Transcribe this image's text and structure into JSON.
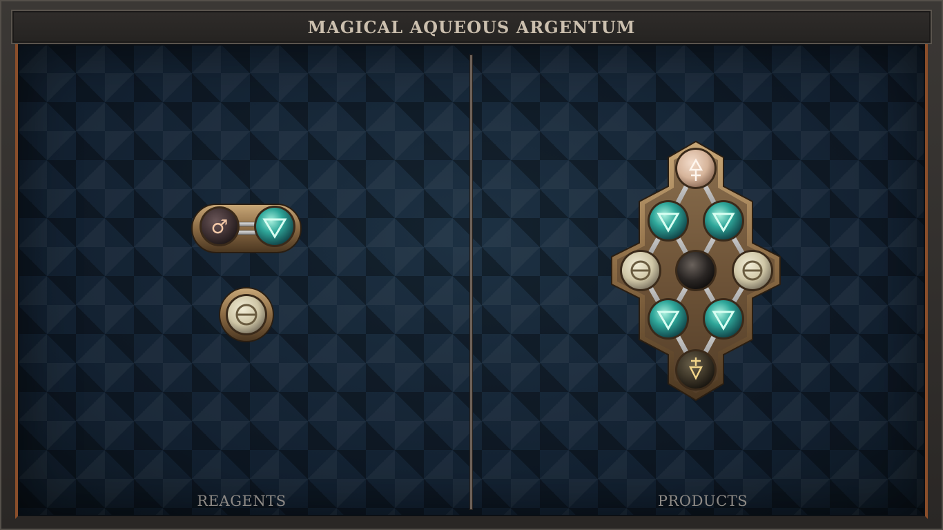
{
  "title": "MAGICAL AQUEOUS ARGENTUM",
  "sections": {
    "reagents_label": "REAGENTS",
    "products_label": "PRODUCTS"
  },
  "colors": {
    "frame": "#3b3835",
    "board": "#152230",
    "accent_copper": "#8a4e2a",
    "title_text": "#cbbfae",
    "label_text": "#8e8a86",
    "bronze": "#9a7a52"
  },
  "atom_types": {
    "iron": {
      "symbol": "♂",
      "fill": "#3e3032"
    },
    "water": {
      "symbol": "🜄",
      "fill": "#2fa79a"
    },
    "salt": {
      "symbol": "⊖",
      "fill": "#cfc6a6"
    },
    "quicksilver": {
      "symbol": "☽",
      "fill": "#2a2624"
    },
    "copper_mix": {
      "symbol": "🜍",
      "fill": "#d6b49a"
    },
    "sulfur_mix": {
      "symbol": "🜏",
      "fill": "#3a3326"
    }
  },
  "reagents": [
    {
      "name": "iron-water-molecule",
      "atoms": [
        "iron",
        "water"
      ],
      "bonds": 1
    },
    {
      "name": "salt-molecule",
      "atoms": [
        "salt"
      ],
      "bonds": 0
    }
  ],
  "product": {
    "name": "argentum-molecule",
    "atoms": [
      "copper_mix",
      "water",
      "water",
      "salt",
      "quicksilver",
      "salt",
      "water",
      "water",
      "sulfur_mix"
    ],
    "bonds": 12
  }
}
